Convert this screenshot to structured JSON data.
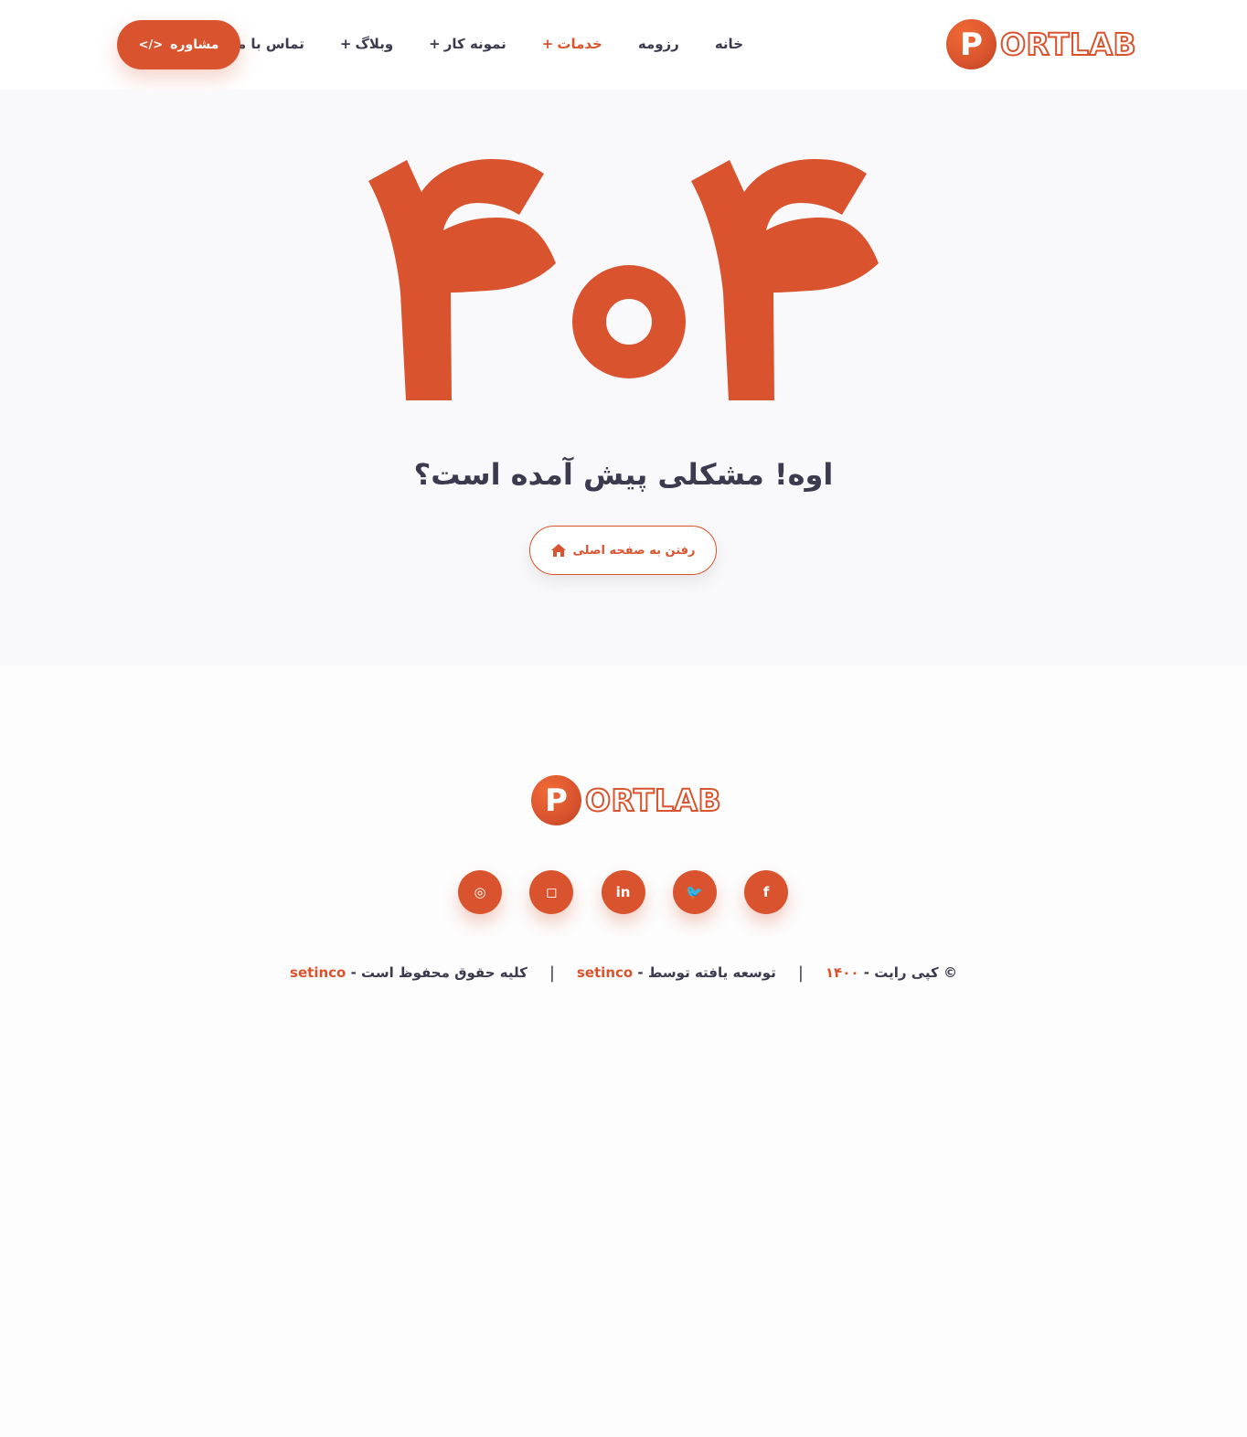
{
  "brand": {
    "logo_letter": "P",
    "logo_word": "ORTLAB",
    "accent_color": "#d9542e",
    "text_color": "#3b3a4f"
  },
  "header": {
    "nav": [
      {
        "label": "خانه",
        "has_submenu": false,
        "active": false
      },
      {
        "label": "رزومه",
        "has_submenu": false,
        "active": false
      },
      {
        "label": "خدمات",
        "has_submenu": true,
        "active": true
      },
      {
        "label": "نمونه کار",
        "has_submenu": true,
        "active": false
      },
      {
        "label": "وبلاگ",
        "has_submenu": true,
        "active": false
      },
      {
        "label": "تماس با ما",
        "has_submenu": false,
        "active": false
      }
    ],
    "submenu_marker": "+",
    "consult_button": {
      "label": "مشاوره",
      "icon": "code-icon",
      "icon_glyph": "</>"
    }
  },
  "hero": {
    "error_code": "404",
    "headline": "اوه! مشکلی پیش آمده است؟",
    "home_button": {
      "label": "رفتن به صفحه اصلی",
      "icon": "home-icon"
    }
  },
  "footer": {
    "socials": [
      {
        "name": "dribbble-icon",
        "glyph": "◎"
      },
      {
        "name": "instagram-icon",
        "glyph": "◻"
      },
      {
        "name": "linkedin-icon",
        "glyph": "in"
      },
      {
        "name": "twitter-icon",
        "glyph": "🐦"
      },
      {
        "name": "facebook-icon",
        "glyph": "f"
      }
    ],
    "copyright": {
      "prefix": "© کپی رایت - ",
      "year": "۱۴۰۰",
      "developed_by": "توسعه یافته توسط - ",
      "developer": "setinco",
      "rights": "کلیه حقوق محفوظ است - ",
      "owner": "setinco",
      "separator": "|"
    }
  }
}
